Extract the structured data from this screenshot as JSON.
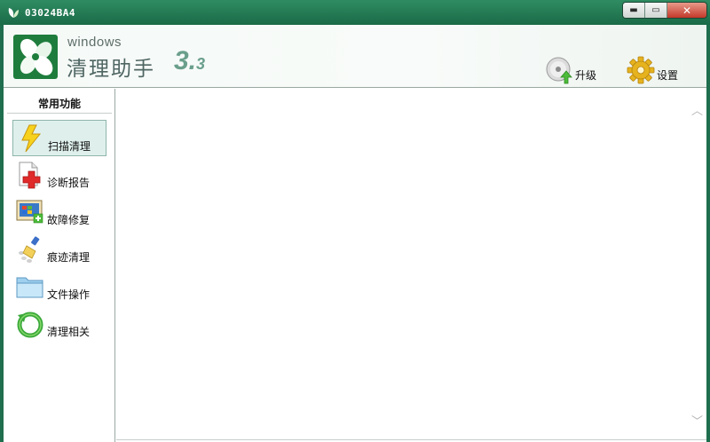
{
  "window": {
    "title": "03024BA4",
    "minimize_glyph": "▬",
    "maximize_glyph": "▭",
    "close_glyph": "✕"
  },
  "header": {
    "logo_small": "windows",
    "logo_main": "清理助手",
    "version_major": "3.",
    "version_minor": "3",
    "upgrade_label": "升级",
    "settings_label": "设置"
  },
  "sidebar": {
    "title": "常用功能",
    "items": [
      {
        "label": "扫描清理",
        "icon": "lightning-icon",
        "active": true
      },
      {
        "label": "诊断报告",
        "icon": "report-icon",
        "active": false
      },
      {
        "label": "故障修复",
        "icon": "monitor-repair-icon",
        "active": false
      },
      {
        "label": "痕迹清理",
        "icon": "broom-icon",
        "active": false
      },
      {
        "label": "文件操作",
        "icon": "folder-icon",
        "active": false
      },
      {
        "label": "清理相关",
        "icon": "refresh-icon",
        "active": false
      }
    ]
  },
  "content": {
    "scroll_up_glyph": "︿",
    "scroll_down_glyph": "﹀"
  },
  "colors": {
    "titlebar": "#1f7a50",
    "logo_green": "#1e7d3c",
    "active_item_bg": "#dff0ec",
    "version_teal": "#6a9f8c"
  }
}
